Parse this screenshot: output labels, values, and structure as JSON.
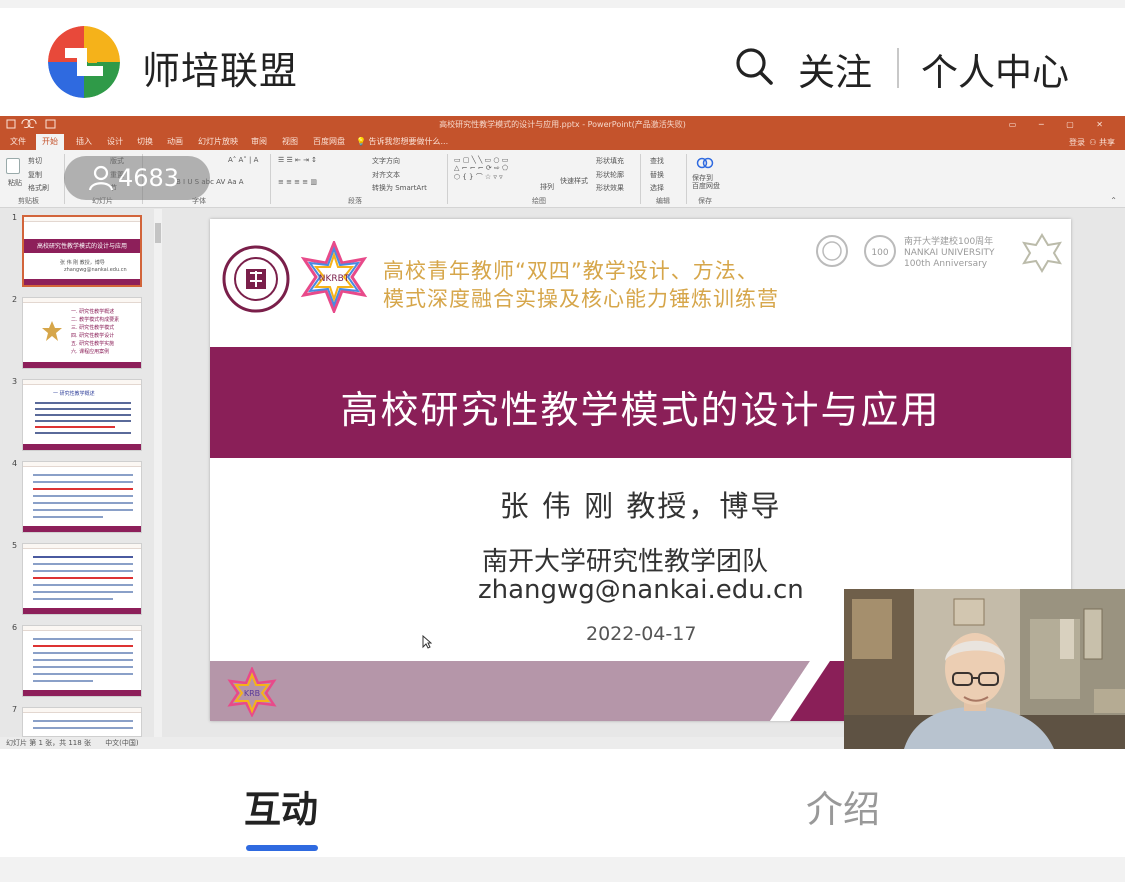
{
  "header": {
    "app_title": "师培联盟",
    "follow_label": "关注",
    "personal_center_label": "个人中心",
    "search_icon": "search-icon",
    "logo_colors": [
      "#e8493a",
      "#f5b21a",
      "#2f9a48",
      "#2f6ae0"
    ]
  },
  "live": {
    "viewer_count": "4683",
    "viewer_icon": "person-icon"
  },
  "powerpoint": {
    "window_title": "高校研究性教学模式的设计与应用.pptx - PowerPoint(产品激活失败)",
    "ribbon_tabs": [
      "文件",
      "开始",
      "插入",
      "设计",
      "切换",
      "动画",
      "幻灯片放映",
      "审阅",
      "视图",
      "百度网盘"
    ],
    "active_tab": "开始",
    "tell_me": "告诉我您想要做什么...",
    "login": "登录",
    "share": "共享",
    "ribbon_groups": [
      "剪贴板",
      "幻灯片",
      "字体",
      "段落",
      "绘图",
      "编辑",
      "保存"
    ],
    "ribbon_items": {
      "paste": "粘贴",
      "cut": "剪切",
      "copy": "复制",
      "format_painter": "格式刷",
      "new_slide": "新建\n幻灯片",
      "layout": "版式",
      "reset": "重置",
      "section": "节",
      "text_direction": "文字方向",
      "align_text": "对齐文本",
      "smartart": "转换为 SmartArt",
      "arrange": "排列",
      "quick_styles": "快速样式",
      "shape_fill": "形状填充",
      "shape_outline": "形状轮廓",
      "shape_effects": "形状效果",
      "find": "查找",
      "replace": "替换",
      "select": "选择",
      "save_to_baidu": "保存到\n百度网盘"
    },
    "statusbar": {
      "slide_info": "幻灯片 第 1 张，共 118 张",
      "language": "中文(中国)"
    },
    "thumbnails": [
      {
        "num": "1",
        "title": "高校研究性教学模式的设计与应用"
      },
      {
        "num": "2"
      },
      {
        "num": "3",
        "title": "一 研究性教学概述"
      },
      {
        "num": "4"
      },
      {
        "num": "5"
      },
      {
        "num": "6"
      },
      {
        "num": "7"
      }
    ],
    "thumb2_items": [
      "一. 研究性教学概述",
      "二. 教学模式构成要素",
      "三. 研究性教学模式",
      "四. 研究性教学设计",
      "五. 研究性教学实施",
      "六. 课程应用案例"
    ]
  },
  "slide": {
    "seal_text": "NANKAI UNIVERSITY",
    "seal_year": "1919",
    "seal_char": "南開",
    "nkrbt": "NKRBT",
    "camp_line1": "高校青年教师“双四”教学设计、方法、",
    "camp_line2": "模式深度融合实操及核心能力锤炼训练营",
    "centenary_line1": "南开大学建校100周年",
    "centenary_line2": "NANKAI UNIVERSITY",
    "centenary_line3": "100th Anniversary",
    "centenary_number": "100",
    "title": "高校研究性教学模式的设计与应用",
    "author": "张 伟 刚 教授，博导",
    "team": "南开大学研究性教学团队",
    "email": "zhangwg@nankai.edu.cn",
    "date": "2022-04-17",
    "krb": "KRB",
    "band_color": "#8a1f58",
    "camp_color": "#d6a64a"
  },
  "bottom_tabs": {
    "interact": "互动",
    "intro": "介绍",
    "active": "互动",
    "indicator_color": "#2f6ae0"
  }
}
